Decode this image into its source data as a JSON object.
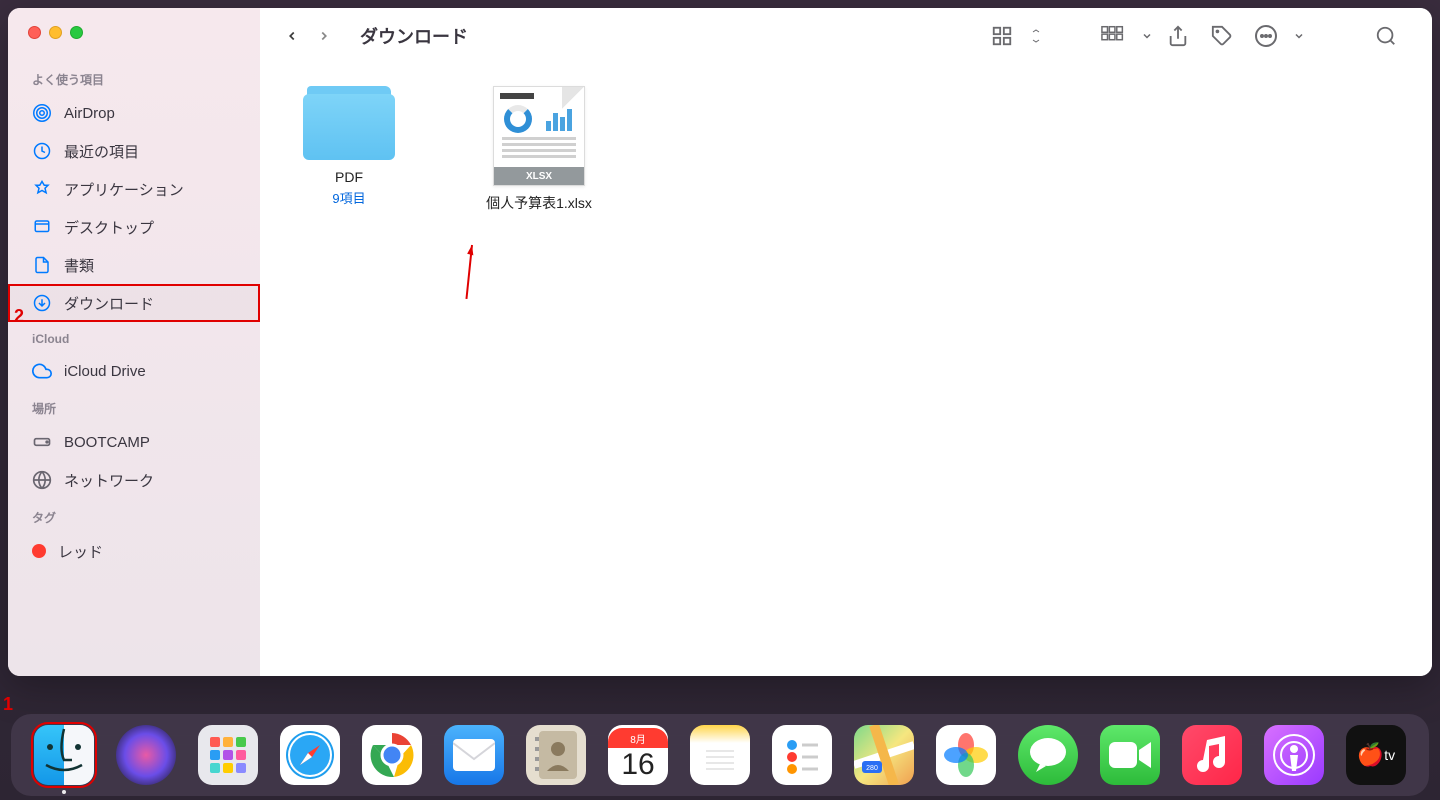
{
  "window": {
    "title": "ダウンロード"
  },
  "sidebar": {
    "sections": {
      "favorites": {
        "header": "よく使う項目",
        "items": [
          "AirDrop",
          "最近の項目",
          "アプリケーション",
          "デスクトップ",
          "書類",
          "ダウンロード"
        ]
      },
      "icloud": {
        "header": "iCloud",
        "items": [
          "iCloud Drive"
        ]
      },
      "locations": {
        "header": "場所",
        "items": [
          "BOOTCAMP",
          "ネットワーク"
        ]
      },
      "tags": {
        "header": "タグ",
        "items": [
          "レッド"
        ]
      }
    }
  },
  "files": {
    "folder": {
      "name": "PDF",
      "sub": "9項目"
    },
    "xlsx": {
      "name": "個人予算表1.xlsx",
      "badge": "XLSX"
    }
  },
  "annotations": {
    "num1": "1",
    "num2": "2"
  },
  "calendar": {
    "month": "8月",
    "day": "16"
  },
  "tv_label": "tv"
}
